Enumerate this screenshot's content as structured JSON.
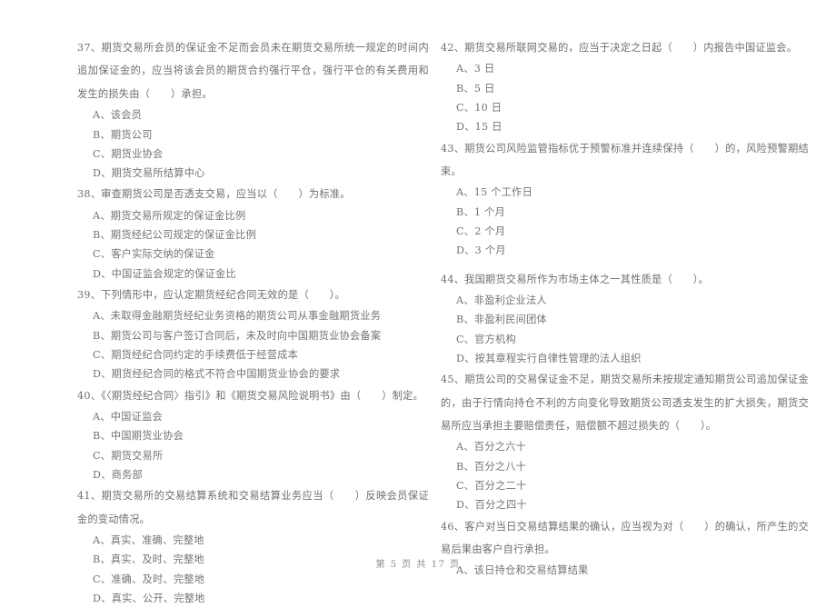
{
  "document": {
    "type": "exam-paper",
    "language": "zh-CN",
    "footer": "第 5 页 共 17 页"
  },
  "columns": [
    {
      "name": "left-column",
      "questions": [
        {
          "number": "37",
          "stem": "37、期货交易所会员的保证金不足而会员未在期货交易所统一规定的时间内追加保证金的，应当将该会员的期货合约强行平仓，强行平仓的有关费用和发生的损失由（　　）承担。",
          "options": [
            "A、该会员",
            "B、期货公司",
            "C、期货业协会",
            "D、期货交易所结算中心"
          ]
        },
        {
          "number": "38",
          "stem": "38、审查期货公司是否透支交易，应当以（　　）为标准。",
          "options": [
            "A、期货交易所规定的保证金比例",
            "B、期货经纪公司规定的保证金比例",
            "C、客户实际交纳的保证金",
            "D、中国证监会规定的保证金比"
          ]
        },
        {
          "number": "39",
          "stem": "39、下列情形中，应认定期货经纪合同无效的是（　　）。",
          "options": [
            "A、未取得金融期货经纪业务资格的期货公司从事金融期货业务",
            "B、期货公司与客户签订合同后，未及时向中国期货业协会备案",
            "C、期货经纪合同约定的手续费低于经营成本",
            "D、期货经纪合同的格式不符合中国期货业协会的要求"
          ]
        },
        {
          "number": "40",
          "stem": "40、《〈期货经纪合同〉指引》和《期货交易风险说明书》由（　　）制定。",
          "options": [
            "A、中国证监会",
            "B、中国期货业协会",
            "C、期货交易所",
            "D、商务部"
          ]
        },
        {
          "number": "41",
          "stem": "41、期货交易所的交易结算系统和交易结算业务应当（　　）反映会员保证金的变动情况。",
          "options": [
            "A、真实、准确、完整地",
            "B、真实、及时、完整地",
            "C、准确、及时、完整地",
            "D、真实、公开、完整地"
          ]
        }
      ]
    },
    {
      "name": "right-column",
      "questions": [
        {
          "number": "42",
          "stem": "42、期货交易所联网交易的，应当于决定之日起（　　）内报告中国证监会。",
          "options": [
            "A、3 日",
            "B、5 日",
            "C、10 日",
            "D、15 日"
          ]
        },
        {
          "number": "43",
          "stem": "43、期货公司风险监管指标优于预警标准并连续保持（　　）的，风险预警期结束。",
          "options": [
            "A、15 个工作日",
            "B、1 个月",
            "C、2 个月",
            "D、3 个月"
          ]
        },
        {
          "number": "44",
          "stem": "44、我国期货交易所作为市场主体之一其性质是（　　）。",
          "options": [
            "A、非盈利企业法人",
            "B、非盈利民间团体",
            "C、官方机构",
            "D、按其章程实行自律性管理的法人组织"
          ]
        },
        {
          "number": "45",
          "stem": "45、期货公司的交易保证金不足，期货交易所未按规定通知期货公司追加保证金的，由于行情向持仓不利的方向变化导致期货公司透支发生的扩大损失，期货交易所应当承担主要赔偿责任，赔偿额不超过损失的（　　）。",
          "options": [
            "A、百分之六十",
            "B、百分之八十",
            "C、百分之二十",
            "D、百分之四十"
          ]
        },
        {
          "number": "46",
          "stem": "46、客户对当日交易结算结果的确认，应当视为对（　　）的确认，所产生的交易后果由客户自行承担。",
          "options": [
            "A、该日持仓和交易结算结果"
          ]
        }
      ]
    }
  ]
}
